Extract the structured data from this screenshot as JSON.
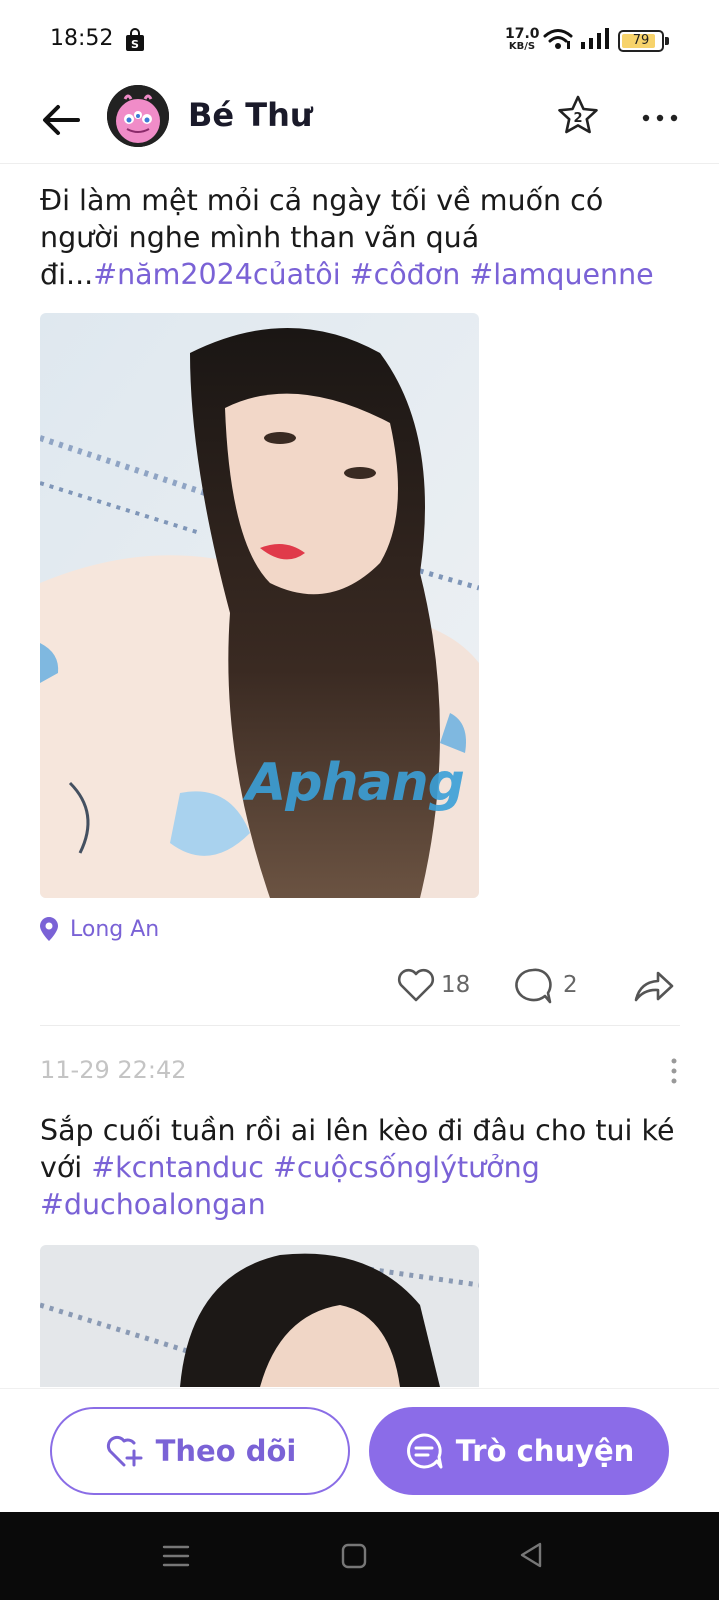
{
  "status_bar": {
    "time": "18:52",
    "net_speed_value": "17.0",
    "net_speed_unit": "KB/S",
    "battery": "79",
    "battery_level": 0.79,
    "icons": [
      "shop-notification-icon",
      "wifi-icon",
      "signal-icon",
      "battery-icon"
    ]
  },
  "header": {
    "name": "Bé Thư",
    "icons": [
      "back-arrow-icon",
      "avatar",
      "star-icon",
      "more-icon"
    ]
  },
  "post1": {
    "text": "Đi làm mệt mỏi cả ngày tối về muốn có người nghe mình than vãn quá đi...",
    "tags": [
      "#năm2024củatôi",
      "#côđơn",
      "#lamquenne"
    ],
    "watermark": "Aphang",
    "location": "Long An",
    "likes": "18",
    "comments": "2"
  },
  "post2": {
    "time": "11-29 22:42",
    "text": "Sắp cuối tuần rồi ai lên kèo đi đâu cho tui ké với",
    "tags": [
      "#kcntanduc",
      "#cuộcsốnglýtưởng",
      "#duchoalongan"
    ]
  },
  "actions": {
    "follow_label": "Theo dõi",
    "chat_label": "Trò chuyện"
  },
  "colors": {
    "accent": "#8b6ce8",
    "tag": "#7a62d6",
    "nav_bar": "#0a0a0a"
  }
}
